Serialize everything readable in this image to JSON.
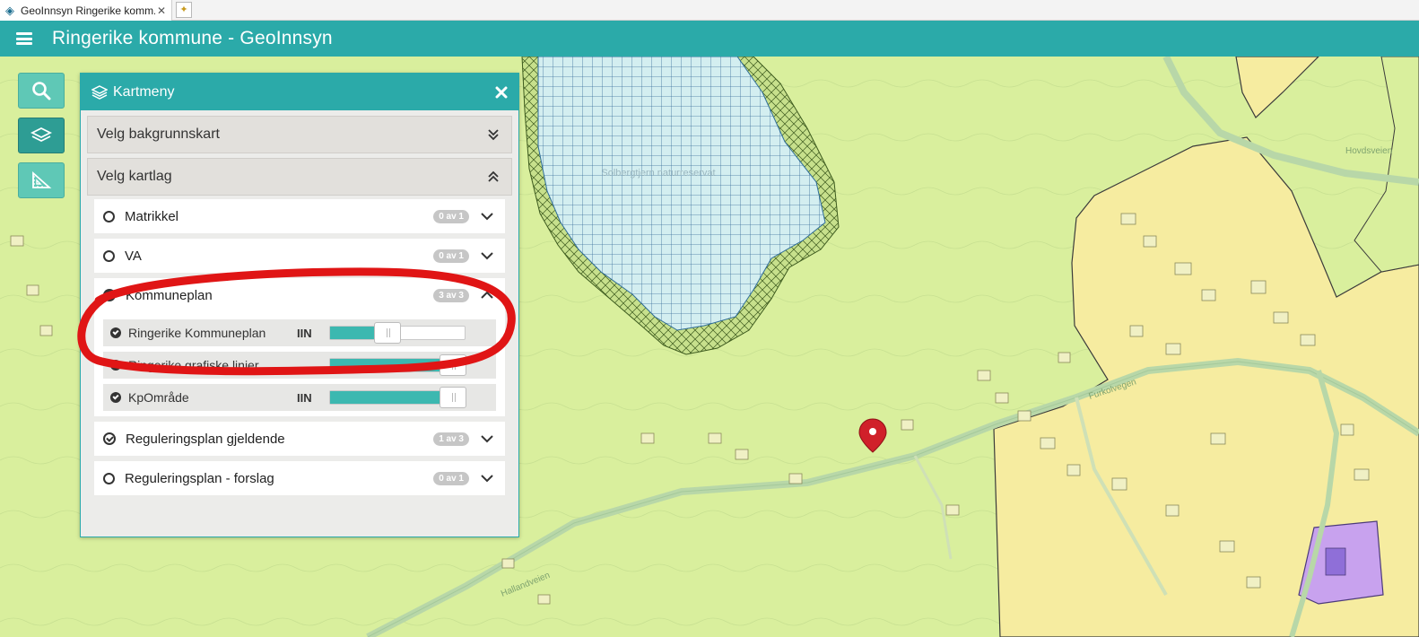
{
  "browser": {
    "tab_title": "GeoInnsyn Ringerike komm...",
    "tab_close": "✕"
  },
  "header": {
    "title": "Ringerike kommune - GeoInnsyn"
  },
  "map_labels": {
    "reserve": "Solbergtjern naturreservat",
    "road_left": "Hallandveien",
    "road_mid": "Furkolvegen",
    "top_right": "Hovdsveien"
  },
  "colors": {
    "header": "#2baaa9",
    "accent_teal": "#3cb8b0",
    "map_green": "#d9ef9d",
    "map_yellow": "#f6eca0",
    "map_purple": "#c8a2ee",
    "marker": "#d0202a",
    "annotation": "#e01515"
  },
  "panel": {
    "title": "Kartmeny",
    "sections": [
      {
        "label": "Velg bakgrunnskart",
        "state": "collapsed"
      },
      {
        "label": "Velg kartlag",
        "state": "expanded"
      }
    ],
    "layers": [
      {
        "label": "Matrikkel",
        "badge": "0 av 1",
        "icon": "radio-empty-icon"
      },
      {
        "label": "VA",
        "badge": "0 av 1",
        "icon": "radio-empty-icon"
      },
      {
        "label": "Kommuneplan",
        "badge": "3 av 3",
        "icon": "check-filled-icon",
        "expanded": true
      },
      {
        "label": "Reguleringsplan gjeldende",
        "badge": "1 av 3",
        "icon": "check-outline-icon"
      },
      {
        "label": "Reguleringsplan - forslag",
        "badge": "0 av 1",
        "icon": "radio-empty-icon"
      }
    ],
    "sublayers": [
      {
        "label": "Ringerike Kommuneplan",
        "lib_icon": "IIN",
        "opacity": 0.4
      },
      {
        "label": "Ringerike grafiske linjer",
        "lib_icon": "",
        "opacity": 1.0
      },
      {
        "label": "KpOmråde",
        "lib_icon": "IIN",
        "opacity": 1.0
      }
    ]
  }
}
